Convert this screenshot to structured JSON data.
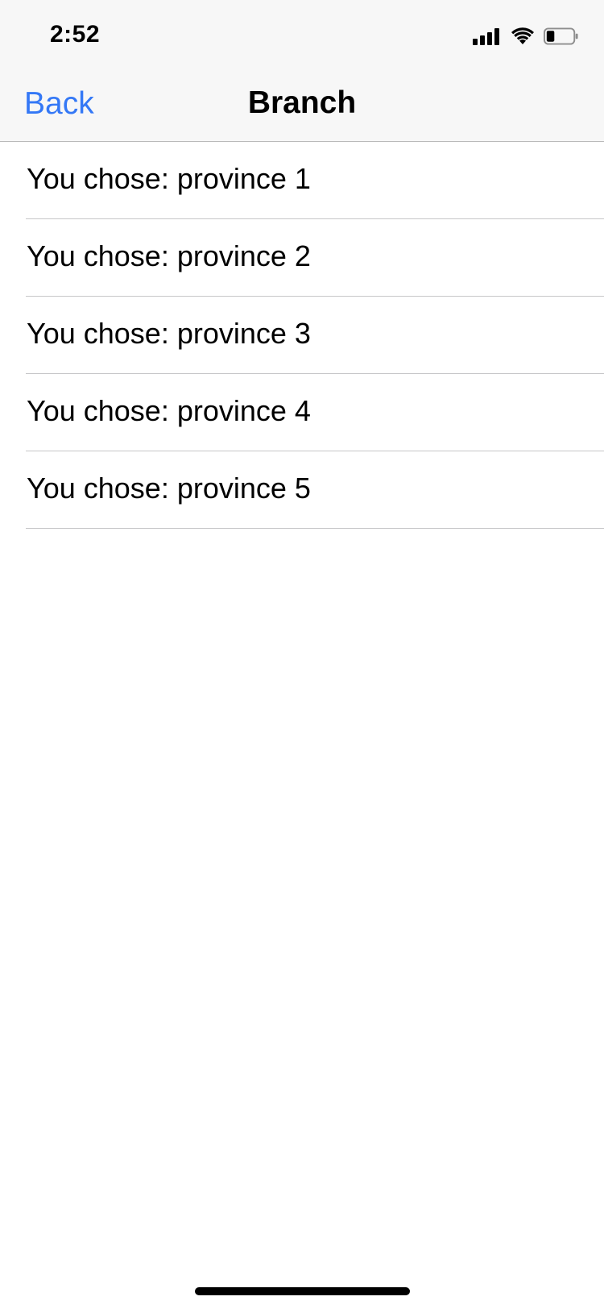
{
  "status_bar": {
    "time": "2:52",
    "icons": [
      "signal-icon",
      "wifi-icon",
      "battery-icon"
    ],
    "battery_level": 0.3
  },
  "nav": {
    "back_label": "Back",
    "title": "Branch",
    "accent_color": "#3478f6"
  },
  "list": {
    "items": [
      {
        "label": "You chose: province 1"
      },
      {
        "label": "You chose: province 2"
      },
      {
        "label": "You chose: province 3"
      },
      {
        "label": "You chose: province 4"
      },
      {
        "label": "You chose: province 5"
      }
    ]
  }
}
